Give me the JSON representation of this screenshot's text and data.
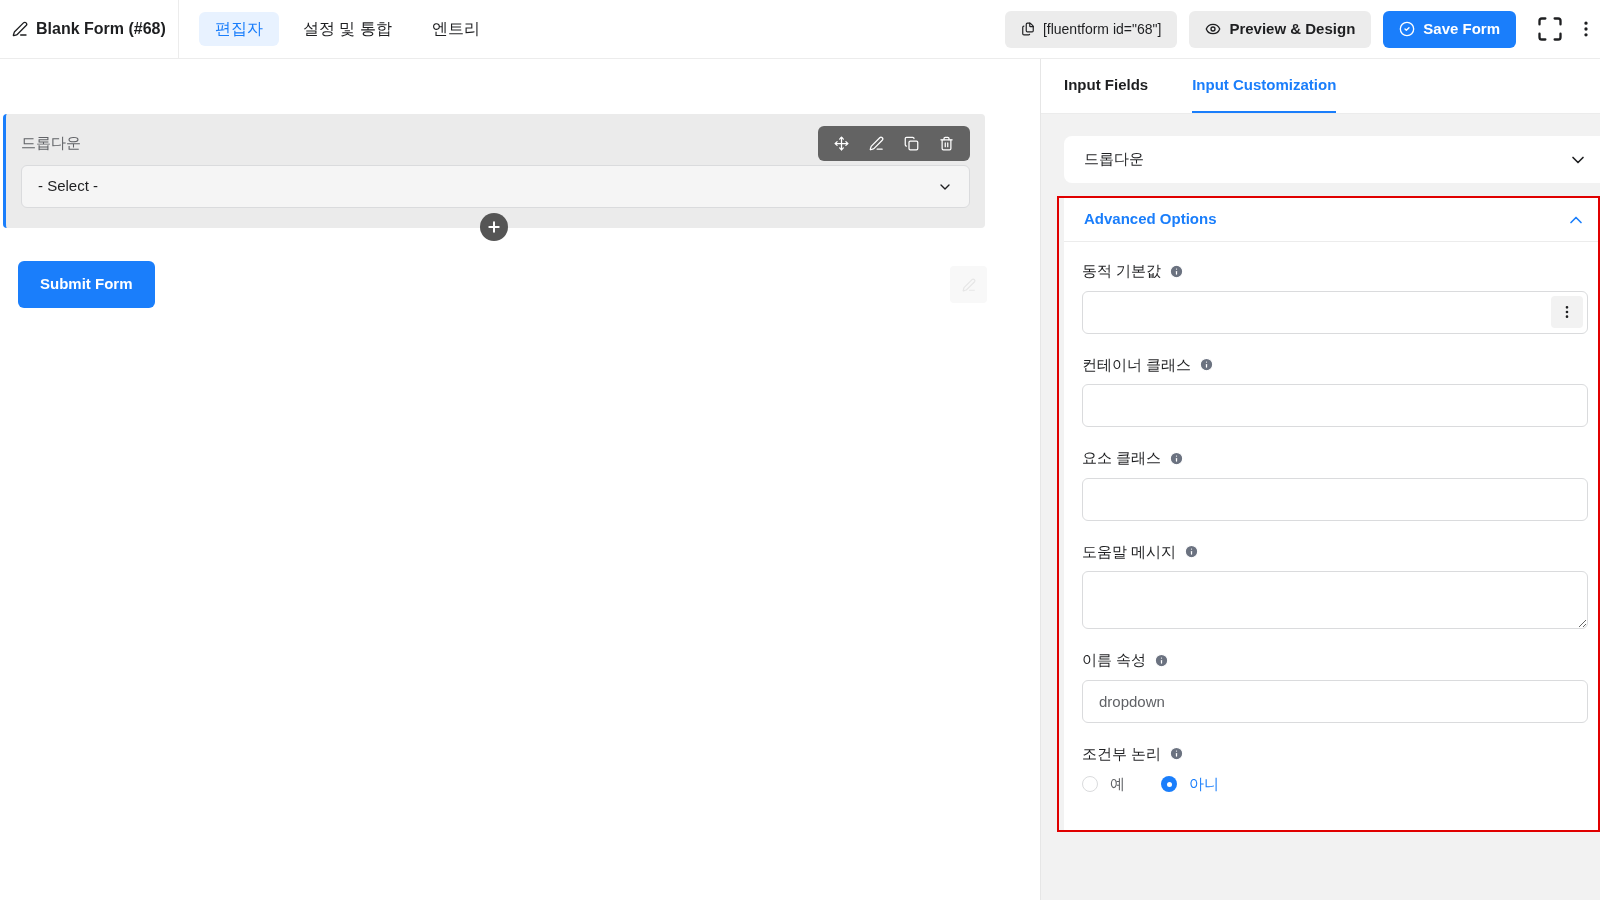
{
  "header": {
    "title": "Blank Form (#68)",
    "tabs": [
      {
        "label": "편집자",
        "selected": true
      },
      {
        "label": "설정 및 통합",
        "selected": false
      },
      {
        "label": "엔트리",
        "selected": false
      }
    ],
    "shortcode": "[fluentform id=\"68\"]",
    "preview_button": "Preview & Design",
    "save_button": "Save Form"
  },
  "canvas": {
    "field": {
      "label": "드롭다운",
      "placeholder": "- Select -"
    },
    "submit_button": "Submit Form"
  },
  "sidebar": {
    "tabs": [
      {
        "label": "Input Fields",
        "selected": false
      },
      {
        "label": "Input Customization",
        "selected": true
      }
    ],
    "sections": [
      {
        "title": "드롭다운",
        "expanded": false,
        "highlighted": false
      },
      {
        "title": "Advanced Options",
        "expanded": true,
        "highlighted": true,
        "fields": [
          {
            "kind": "input-menu",
            "label": "동적 기본값"
          },
          {
            "kind": "input",
            "label": "컨테이너 클래스"
          },
          {
            "kind": "input",
            "label": "요소 클래스"
          },
          {
            "kind": "textarea",
            "label": "도움말 메시지"
          },
          {
            "kind": "input",
            "label": "이름 속성",
            "value": "dropdown"
          },
          {
            "kind": "radio",
            "label": "조건부 논리",
            "options": [
              {
                "label": "예",
                "selected": false
              },
              {
                "label": "아니",
                "selected": true
              }
            ]
          }
        ]
      }
    ]
  }
}
